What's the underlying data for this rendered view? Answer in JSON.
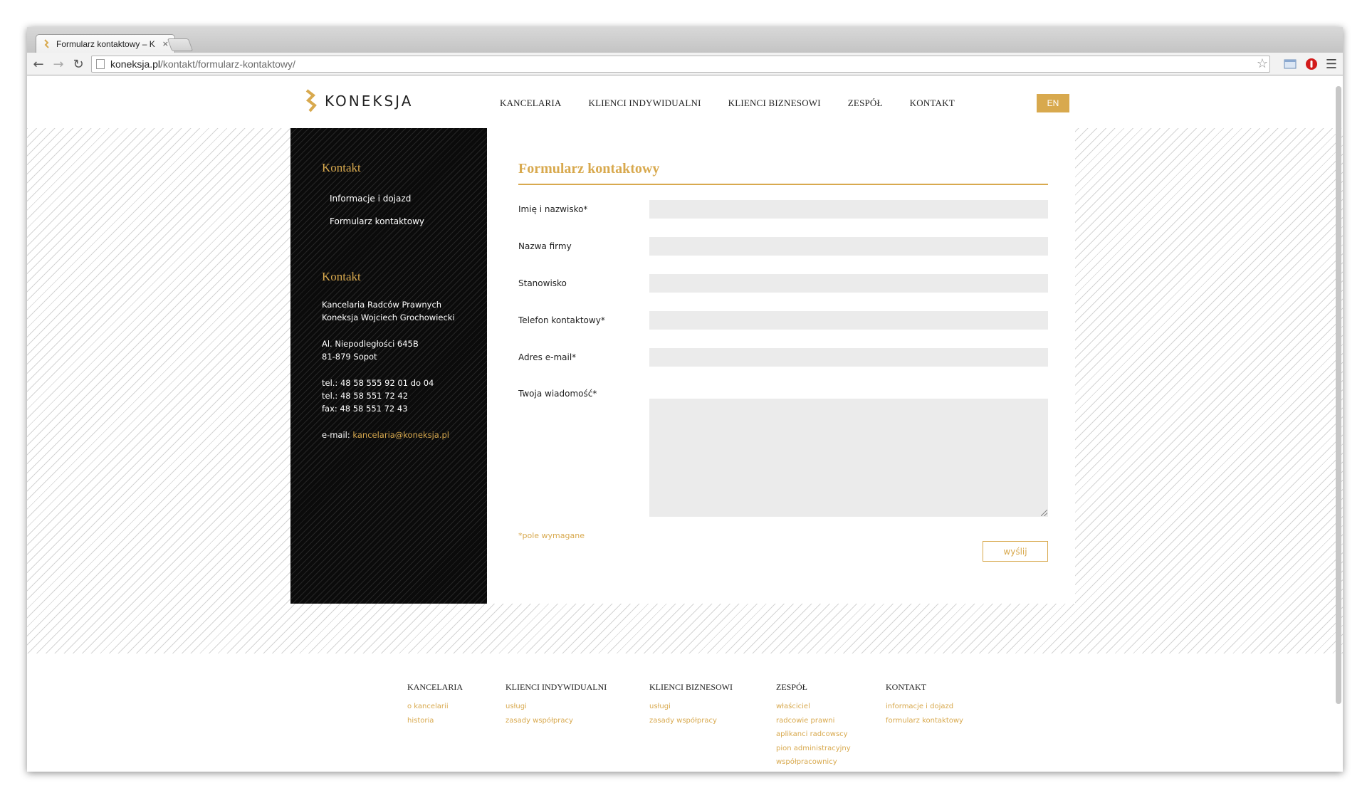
{
  "browser": {
    "tab_title": "Formularz kontaktowy – K",
    "tab_close": "×",
    "url_host": "koneksja.pl",
    "url_path": "/kontakt/formularz-kontaktowy/"
  },
  "site": {
    "logo_text": "KONEKSJA",
    "nav": [
      "KANCELARIA",
      "KLIENCI INDYWIDUALNI",
      "KLIENCI BIZNESOWI",
      "ZESPÓŁ",
      "KONTAKT"
    ],
    "lang": "EN",
    "accent_color": "#d8a94e"
  },
  "sidebar": {
    "heading1": "Kontakt",
    "links": [
      "Informacje i dojazd",
      "Formularz kontaktowy"
    ],
    "heading2": "Kontakt",
    "company_line1": "Kancelaria Radców Prawnych",
    "company_line2": "Koneksja Wojciech Grochowiecki",
    "address_line1": "Al. Niepodległości 645B",
    "address_line2": "81-879 Sopot",
    "tel1": "tel.: 48 58 555 92 01 do 04",
    "tel2": "tel.: 48 58 551 72 42",
    "fax": "fax: 48 58 551 72 43",
    "email_label": "e-mail: ",
    "email": "kancelaria@koneksja.pl"
  },
  "form": {
    "title": "Formularz kontaktowy",
    "labels": {
      "name": "Imię i nazwisko*",
      "company": "Nazwa firmy",
      "position": "Stanowisko",
      "phone": "Telefon kontaktowy*",
      "email": "Adres e-mail*",
      "message": "Twoja wiadomość*"
    },
    "required_note": "*pole wymagane",
    "submit": "wyślij"
  },
  "footer": {
    "columns": [
      {
        "heading": "KANCELARIA",
        "links": [
          "o kancelarii",
          "historia"
        ]
      },
      {
        "heading": "KLIENCI INDYWIDUALNI",
        "links": [
          "usługi",
          "zasady współpracy"
        ]
      },
      {
        "heading": "KLIENCI BIZNESOWI",
        "links": [
          "usługi",
          "zasady współpracy"
        ]
      },
      {
        "heading": "ZESPÓŁ",
        "links": [
          "właściciel",
          "radcowie prawni",
          "aplikanci radcowscy",
          "pion administracyjny",
          "współpracownicy"
        ]
      },
      {
        "heading": "KONTAKT",
        "links": [
          "informacje i dojazd",
          "formularz kontaktowy"
        ]
      }
    ]
  }
}
